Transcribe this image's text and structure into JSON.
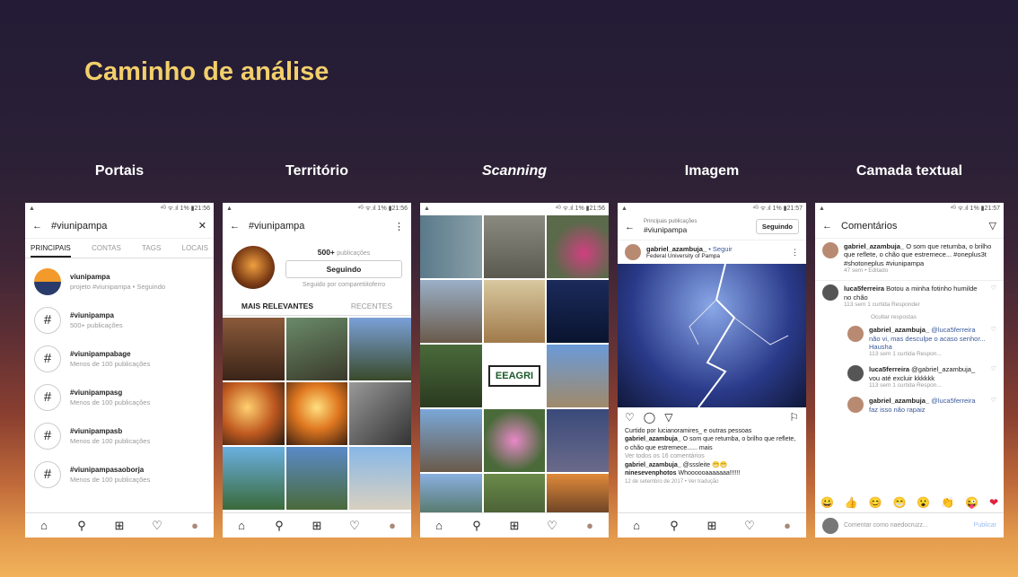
{
  "slide_title": "Caminho de análise",
  "columns": [
    "Portais",
    "Território",
    "Scanning",
    "Imagem",
    "Camada textual"
  ],
  "status": {
    "left": "▲",
    "right1": "21:56",
    "right2": "21:57",
    "signal": "⁴ᴳ ᯤ.ıl 1% ▮"
  },
  "nav_icons": [
    "⌂",
    "🔍",
    "⊞",
    "♡",
    "●"
  ],
  "p1": {
    "title": "#viunipampa",
    "tabs": [
      "PRINCIPAIS",
      "CONTAS",
      "TAGS",
      "LOCAIS"
    ],
    "items": [
      {
        "t": "viunipampa",
        "s": "projeto #viunipampa • Seguindo"
      },
      {
        "t": "#viunipampa",
        "s": "500+ publicações"
      },
      {
        "t": "#viunipampabage",
        "s": "Menos de 100 publicações"
      },
      {
        "t": "#viunipampasg",
        "s": "Menos de 100 publicações"
      },
      {
        "t": "#viunipampasb",
        "s": "Menos de 100 publicações"
      },
      {
        "t": "#viunipampasaoborja",
        "s": "Menos de 100 publicações"
      }
    ]
  },
  "p2": {
    "title": "#viunipampa",
    "count": "500+",
    "count_suffix": "publicações",
    "follow": "Seguindo",
    "followed_by": "Seguido por comparetiitoferro",
    "tab_a": "MAIS RELEVANTES",
    "tab_b": "RECENTES"
  },
  "p3": {
    "logo_text": "EEAGRI"
  },
  "p4": {
    "header_small": "Principais publicações",
    "header": "#viunipampa",
    "follow": "Seguindo",
    "user": "gabriel_azambuja_",
    "follow_link": "• Seguir",
    "location": "Federal University of Pampa",
    "liked": "Curtido por lucianoramires_ e outras pessoas",
    "caption_user": "gabriel_azambuja_",
    "caption": "O som que retumba, o brilho que reflete, o chão que estremece...... mais",
    "view_all": "Ver todos os 16 comentários",
    "c1_user": "gabriel_azambuja_",
    "c1": "@sssleite 😁😁",
    "c2_user": "ninesevenphotos",
    "c2": "Whoooooaaaaaaa!!!!!!",
    "date": "12 de setembro de 2017 • Ver tradução"
  },
  "p5": {
    "title": "Comentários",
    "main": {
      "user": "gabriel_azambuja_",
      "text": "O som que retumba, o brilho que reflete, o chão que estremece... #oneplus3t #shotoneplus #viunipampa",
      "meta": "47 sem • Editado"
    },
    "c1": {
      "user": "luca5ferreira",
      "text": "Botou a minha fotinho humilde no chão",
      "meta": "113 sem    1 curtida    Responder"
    },
    "hide": "Ocultar respostas",
    "c2": {
      "user": "gabriel_azambuja_",
      "text": "@luca5ferreira não vi, mas desculpe o acaso senhor... Hausha",
      "meta": "113 sem    1 curtida    Respon..."
    },
    "c3": {
      "user": "luca5ferreira",
      "text": "@gabriel_azambuja_ vou até excluir kkkkkk",
      "meta": "113 sem    1 curtida    Respon..."
    },
    "c4": {
      "user": "gabriel_azambuja_",
      "text": "@luca5ferreira faz isso não rapaiz",
      "meta": ""
    },
    "emojis": [
      "😀",
      "👍",
      "😊",
      "😁",
      "😮",
      "👏",
      "😜",
      "❤"
    ],
    "placeholder": "Comentar como naedocruzz...",
    "publish": "Publicar"
  }
}
